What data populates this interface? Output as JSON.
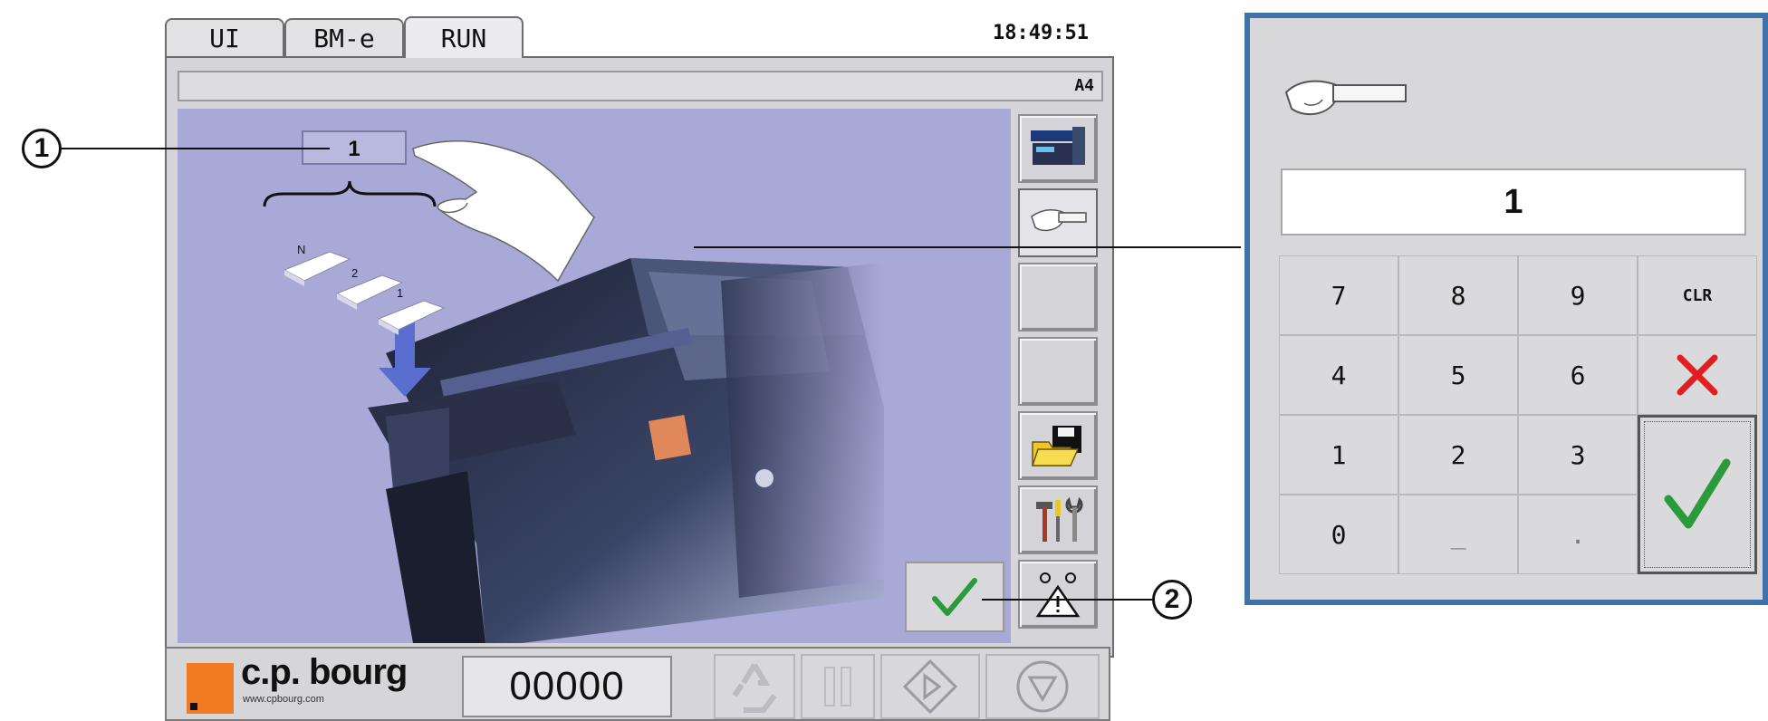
{
  "tabs": [
    {
      "label": "UI",
      "active": false
    },
    {
      "label": "BM-e",
      "active": false
    },
    {
      "label": "RUN",
      "active": true
    }
  ],
  "clock": "18:49:51",
  "status_code": "A4",
  "scene": {
    "count_value": "1",
    "sheet_labels": [
      "N",
      "2",
      "1"
    ]
  },
  "sidebar": {
    "items": [
      {
        "icon": "machine-icon"
      },
      {
        "icon": "hand-feed-icon",
        "selected": true
      },
      {
        "icon": "empty"
      },
      {
        "icon": "empty"
      },
      {
        "icon": "save-folder-icon"
      },
      {
        "icon": "tools-icon"
      },
      {
        "icon": "warning-icon"
      }
    ]
  },
  "ok_button_icon": "checkmark-icon",
  "bottom": {
    "logo_text": "c.p. bourg",
    "logo_url": "www.cpbourg.com",
    "counter": "00000",
    "buttons": [
      "recycle-icon",
      "pause-icon",
      "start-icon",
      "stop-icon"
    ]
  },
  "callouts": [
    "1",
    "2"
  ],
  "keypad": {
    "display": "1",
    "keys": [
      [
        "7",
        "8",
        "9",
        "CLR"
      ],
      [
        "4",
        "5",
        "6",
        "cancel"
      ],
      [
        "1",
        "2",
        "3",
        "enter"
      ],
      [
        "0",
        "_",
        ".",
        ""
      ]
    ],
    "labels": {
      "k7": "7",
      "k8": "8",
      "k9": "9",
      "clr": "CLR",
      "k4": "4",
      "k5": "5",
      "k6": "6",
      "k1": "1",
      "k2": "2",
      "k3": "3",
      "k0": "0",
      "underscore": "_",
      "dot": "."
    }
  },
  "colors": {
    "scene_bg": "#a9a9d8",
    "logo_orange": "#f07a22",
    "check_green": "#2a9a3a",
    "cancel_red": "#e02020",
    "dialog_border": "#3e72a8"
  }
}
